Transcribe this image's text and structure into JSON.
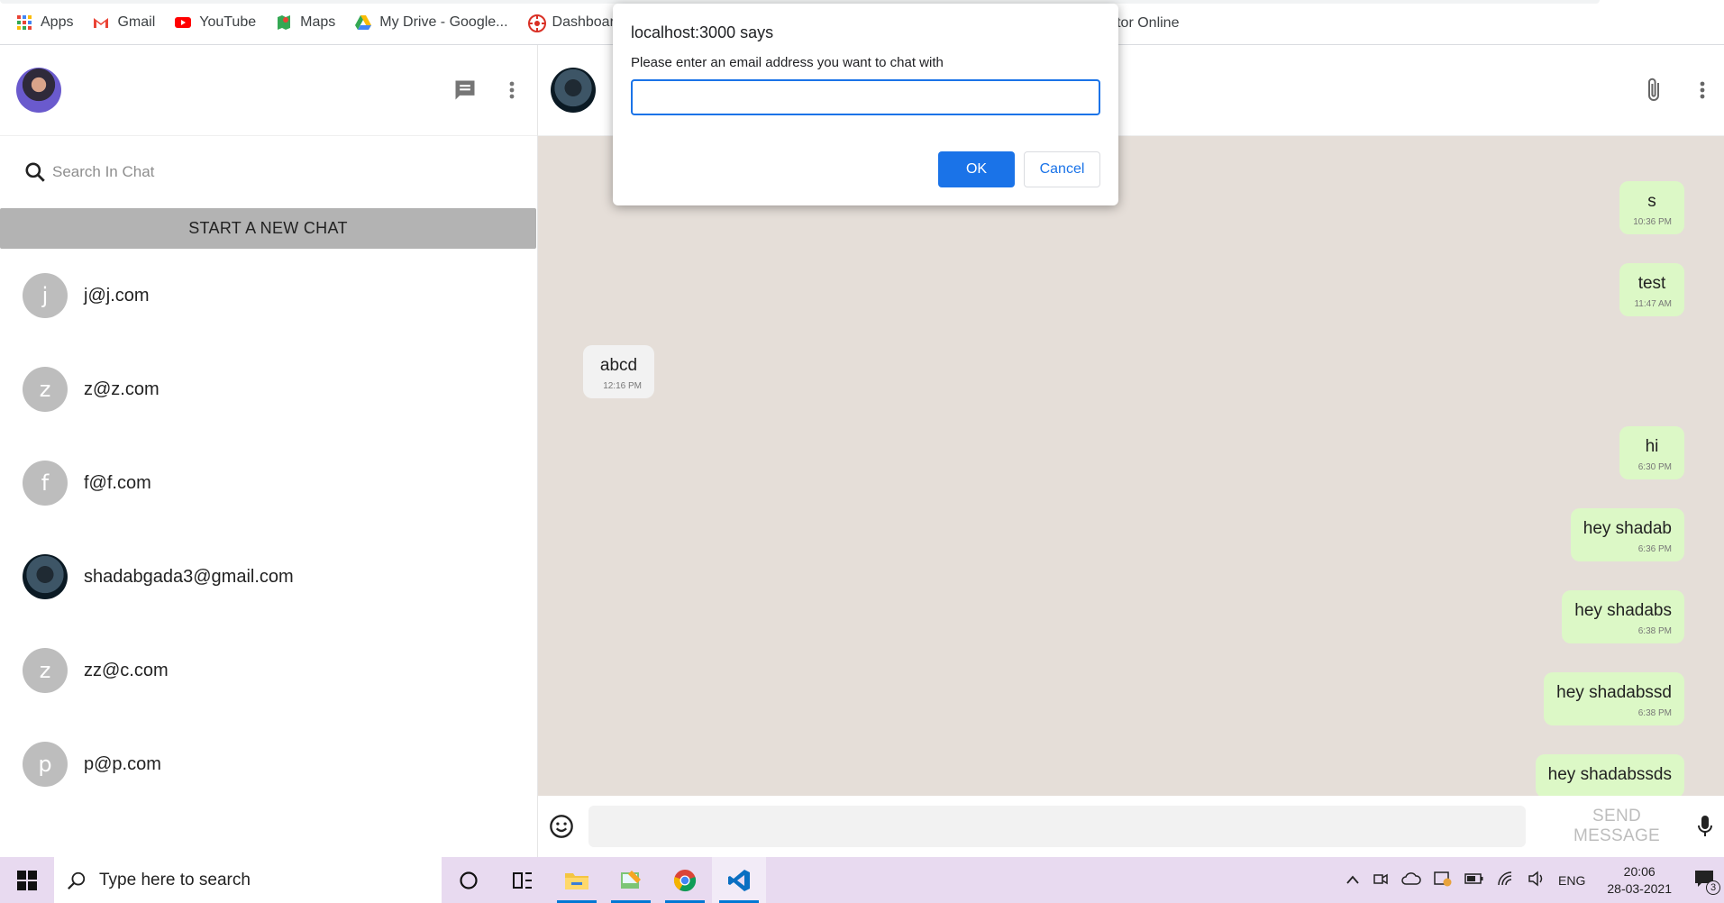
{
  "bookmarks": {
    "items": [
      {
        "label": "Apps",
        "icon": "apps-grid-icon"
      },
      {
        "label": "Gmail",
        "icon": "gmail-icon"
      },
      {
        "label": "YouTube",
        "icon": "youtube-icon"
      },
      {
        "label": "Maps",
        "icon": "maps-icon"
      },
      {
        "label": "My Drive - Google...",
        "icon": "drive-icon"
      },
      {
        "label": "Dashboard",
        "icon": "dashboard-icon"
      }
    ],
    "partial_label": "litor Online"
  },
  "sidebar": {
    "search_placeholder": "Search In Chat",
    "new_chat_label": "START A NEW CHAT",
    "chats": [
      {
        "initial": "j",
        "name": "j@j.com"
      },
      {
        "initial": "z",
        "name": "z@z.com"
      },
      {
        "initial": "f",
        "name": "f@f.com"
      },
      {
        "initial": "",
        "name": "shadabgada3@gmail.com"
      },
      {
        "initial": "z",
        "name": "zz@c.com"
      },
      {
        "initial": "p",
        "name": "p@p.com"
      }
    ]
  },
  "messages": [
    {
      "text": "s",
      "time": "10:36 PM",
      "dir": "out"
    },
    {
      "text": "test",
      "time": "11:47 AM",
      "dir": "out"
    },
    {
      "text": "abcd",
      "time": "12:16 PM",
      "dir": "in"
    },
    {
      "text": "hi",
      "time": "6:30 PM",
      "dir": "out"
    },
    {
      "text": "hey shadab",
      "time": "6:36 PM",
      "dir": "out"
    },
    {
      "text": "hey shadabs",
      "time": "6:38 PM",
      "dir": "out"
    },
    {
      "text": "hey shadabssd",
      "time": "6:38 PM",
      "dir": "out"
    },
    {
      "text": "hey shadabssds",
      "time": "",
      "dir": "out"
    }
  ],
  "composer": {
    "send_label": "SEND MESSAGE",
    "input_value": ""
  },
  "dialog": {
    "title": "localhost:3000 says",
    "message": "Please enter an email address you want to chat with",
    "input_value": "",
    "ok_label": "OK",
    "cancel_label": "Cancel"
  },
  "taskbar": {
    "search_placeholder": "Type here to search",
    "language": "ENG",
    "time": "20:06",
    "date": "28-03-2021",
    "notification_count": "3"
  },
  "colors": {
    "accent_blue": "#1a73e8",
    "bubble_out": "#dcf8c6",
    "chat_bg": "#e5ded8",
    "taskbar_bg": "#e8daf0"
  }
}
